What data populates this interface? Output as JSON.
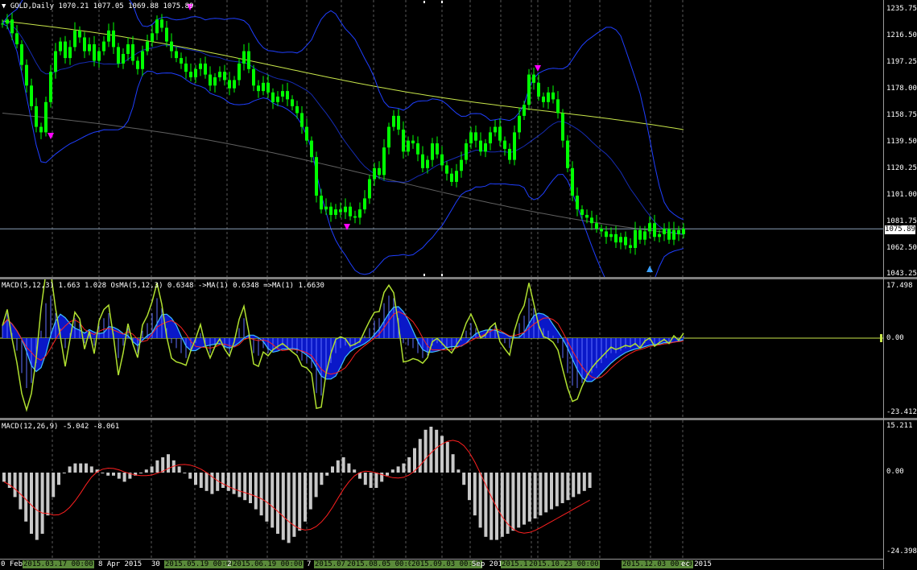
{
  "main_pane": {
    "label": "GOLD,Daily  1070.21 1077.05 1069.88 1075.89",
    "price_ticks": [
      "1235.75",
      "1216.50",
      "1197.25",
      "1178.00",
      "1158.75",
      "1139.50",
      "1120.25",
      "1101.00",
      "1081.75",
      "1062.50",
      "1043.25"
    ],
    "current_price": "1075.89",
    "colors": {
      "bull": "#00ff00",
      "bear": "#00ff00",
      "bands": "#1f3fff",
      "ma_long": "#c8e64a",
      "ma_mid": "#606060",
      "arrow_down": "#ff00ff",
      "arrow_up": "#3aa0ff"
    }
  },
  "osma_pane": {
    "label": "MACD(5,12,3) 1.663 1.028  OsMA(5,12,3) 0.6348  ->MA(1) 0.6348  =>MA(1) 1.6630",
    "ticks": [
      "17.498",
      "0.00",
      "-23.412"
    ]
  },
  "macd_pane": {
    "label": "MACD(12,26,9) -5.042 -8.061",
    "ticks": [
      "15.211",
      "0.00",
      "-24.398"
    ]
  },
  "x_axis": {
    "labels": [
      "0 Feb",
      "8 Apr 2015",
      "30",
      "2",
      "7",
      "Sep 2015",
      "ec 2015"
    ],
    "highlighted": [
      "2015.03.17 00:00",
      "2015.05.19 00:00",
      "2015.06.19 00:00",
      "2015.07",
      "2015.08.05 00:00",
      "2015.09.03 00:00",
      "2015.10",
      "2015.10.23 00:00",
      "2015.12.03 00:00"
    ]
  },
  "chart_data": {
    "type": "line",
    "title": "GOLD,Daily",
    "close": [
      1225,
      1228,
      1218,
      1210,
      1195,
      1180,
      1165,
      1150,
      1146,
      1168,
      1190,
      1205,
      1212,
      1200,
      1208,
      1220,
      1215,
      1205,
      1210,
      1198,
      1205,
      1212,
      1220,
      1208,
      1196,
      1203,
      1210,
      1198,
      1192,
      1205,
      1212,
      1218,
      1228,
      1222,
      1212,
      1205,
      1200,
      1196,
      1190,
      1186,
      1192,
      1196,
      1188,
      1180,
      1186,
      1190,
      1184,
      1178,
      1184,
      1196,
      1205,
      1192,
      1180,
      1176,
      1182,
      1175,
      1168,
      1172,
      1176,
      1170,
      1165,
      1160,
      1150,
      1140,
      1128,
      1100,
      1090,
      1092,
      1086,
      1090,
      1088,
      1092,
      1085,
      1084,
      1090,
      1098,
      1112,
      1120,
      1115,
      1135,
      1150,
      1158,
      1148,
      1132,
      1140,
      1138,
      1130,
      1120,
      1126,
      1138,
      1130,
      1122,
      1116,
      1110,
      1118,
      1126,
      1138,
      1146,
      1140,
      1132,
      1138,
      1146,
      1150,
      1140,
      1134,
      1126,
      1146,
      1158,
      1166,
      1188,
      1182,
      1172,
      1168,
      1175,
      1170,
      1160,
      1140,
      1120,
      1100,
      1090,
      1086,
      1084,
      1080,
      1076,
      1074,
      1070,
      1072,
      1066,
      1070,
      1064,
      1062,
      1075,
      1068,
      1074,
      1080,
      1070,
      1072,
      1076,
      1068,
      1075,
      1072,
      1076
    ],
    "osma": [
      5,
      10,
      2,
      -5,
      -14,
      -20,
      -18,
      -10,
      3,
      14,
      17,
      10,
      4,
      -4,
      2,
      8,
      6,
      -2,
      3,
      -3,
      5,
      8,
      10,
      2,
      -8,
      -3,
      4,
      -2,
      -6,
      3,
      6,
      10,
      16,
      12,
      4,
      -2,
      -4,
      -6,
      -8,
      -5,
      -2,
      2,
      -3,
      -6,
      -3,
      -1,
      -4,
      -6,
      -2,
      4,
      8,
      2,
      -6,
      -7,
      -4,
      -6,
      -5,
      -4,
      -3,
      -4,
      -5,
      -6,
      -9,
      -10,
      -12,
      -22,
      -23,
      -15,
      -10,
      -6,
      -4,
      -3,
      -4,
      -3,
      -2,
      1,
      4,
      7,
      8,
      14,
      17,
      16,
      8,
      -2,
      -3,
      -4,
      -6,
      -8,
      -7,
      -3,
      -2,
      -3,
      -4,
      -5,
      -3,
      -1,
      3,
      6,
      4,
      1,
      2,
      4,
      5,
      0,
      -2,
      -4,
      2,
      6,
      9,
      16,
      12,
      7,
      4,
      3,
      1,
      -2,
      -8,
      -14,
      -19,
      -20,
      -18,
      -16,
      -14,
      -12,
      -10,
      -8,
      -6,
      -6,
      -5,
      -4,
      -4,
      -3,
      -4,
      -2,
      -1,
      -3,
      -2,
      -1,
      -2,
      0,
      -1,
      1
    ],
    "macd": [
      -3,
      -5,
      -8,
      -12,
      -16,
      -20,
      -22,
      -20,
      -14,
      -8,
      -4,
      0,
      2,
      3,
      3,
      3,
      2,
      1,
      0,
      -1,
      -1,
      -2,
      -3,
      -2,
      -1,
      0,
      1,
      2,
      4,
      5,
      6,
      4,
      2,
      0,
      -2,
      -4,
      -5,
      -6,
      -7,
      -6,
      -5,
      -6,
      -7,
      -8,
      -9,
      -10,
      -12,
      -14,
      -16,
      -18,
      -20,
      -22,
      -23,
      -21,
      -19,
      -16,
      -12,
      -8,
      -4,
      -1,
      2,
      4,
      5,
      3,
      1,
      -2,
      -4,
      -5,
      -5,
      -3,
      -1,
      1,
      2,
      3,
      5,
      8,
      11,
      14,
      15,
      14,
      12,
      10,
      6,
      1,
      -4,
      -9,
      -14,
      -18,
      -21,
      -22,
      -22,
      -21,
      -20,
      -19,
      -18,
      -17,
      -16,
      -15,
      -14,
      -13,
      -12,
      -11,
      -10,
      -9,
      -8,
      -7,
      -6,
      -5
    ]
  }
}
